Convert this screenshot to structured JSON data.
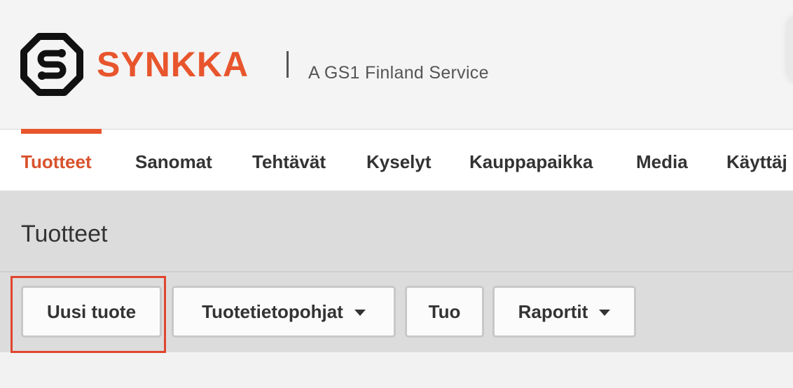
{
  "header": {
    "brand": "SYNKKA",
    "tagline": "A GS1 Finland Service",
    "logo_icon": "synkka-logo-icon"
  },
  "colors": {
    "accent": "#e8552d",
    "highlight": "#e0452d"
  },
  "nav": {
    "items": [
      {
        "label": "Tuotteet",
        "active": true
      },
      {
        "label": "Sanomat"
      },
      {
        "label": "Tehtävät"
      },
      {
        "label": "Kyselyt"
      },
      {
        "label": "Kauppapaikka"
      },
      {
        "label": "Media"
      },
      {
        "label": "Käyttäj"
      }
    ]
  },
  "page": {
    "title": "Tuotteet"
  },
  "toolbar": {
    "buttons": [
      {
        "label": "Uusi tuote"
      },
      {
        "label": "Tuotetietopohjat",
        "dropdown": true
      },
      {
        "label": "Tuo"
      },
      {
        "label": "Raportit",
        "dropdown": true
      }
    ]
  }
}
